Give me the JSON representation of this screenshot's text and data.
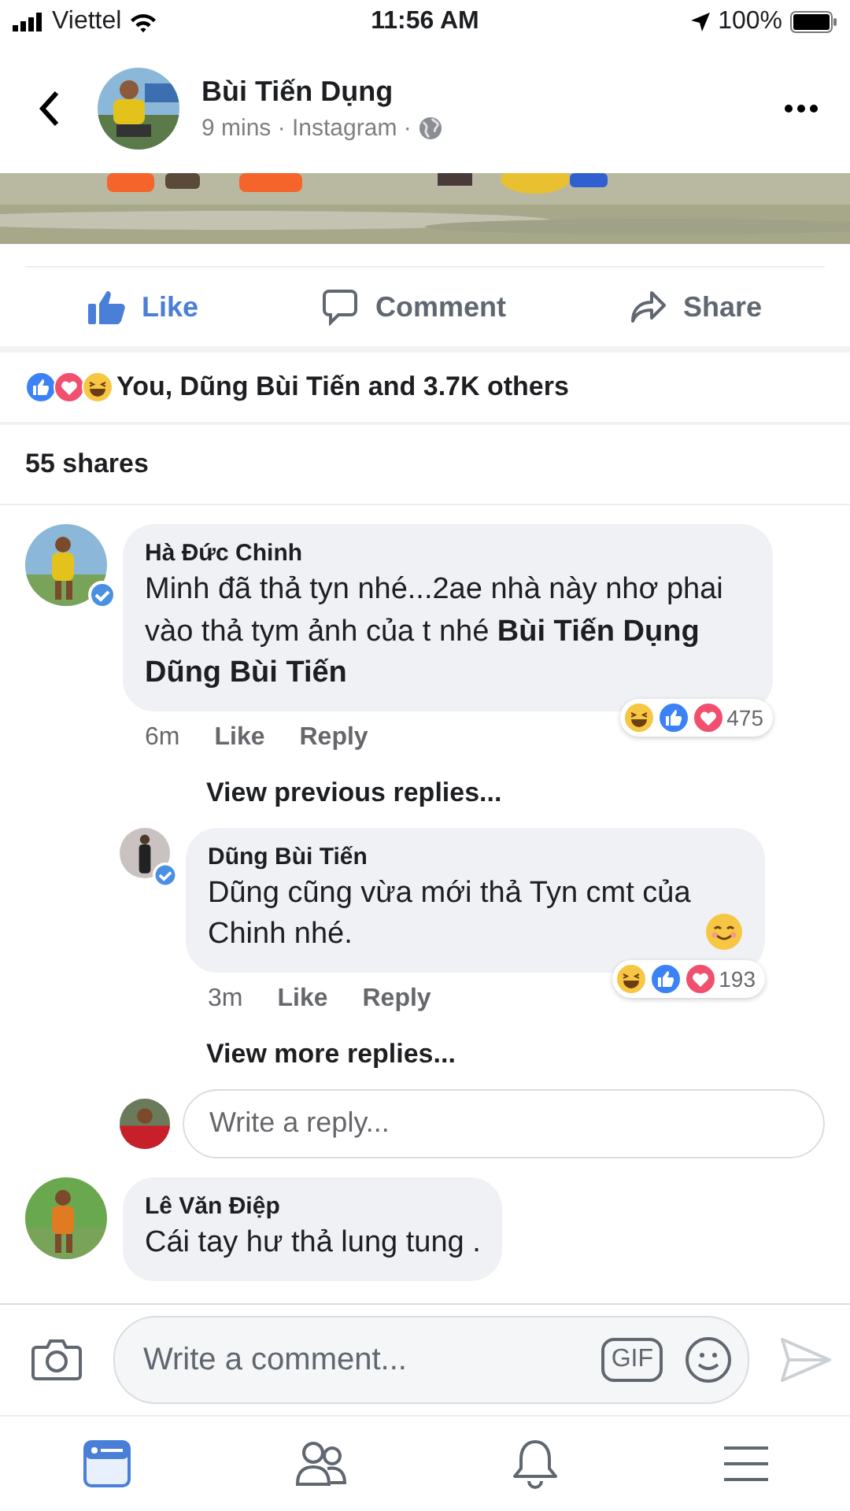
{
  "status_bar": {
    "carrier": "Viettel",
    "time": "11:56 AM",
    "battery": "100%"
  },
  "post": {
    "author": "Bùi Tiến Dụng",
    "meta": "9 mins · Instagram ·"
  },
  "actions": [
    {
      "kind": "like",
      "label": "Like",
      "selected": true
    },
    {
      "kind": "comment",
      "label": "Comment",
      "selected": false
    },
    {
      "kind": "share",
      "label": "Share",
      "selected": false
    }
  ],
  "reaction_summary": {
    "reactions": [
      {
        "kind": "like"
      },
      {
        "kind": "love"
      },
      {
        "kind": "haha"
      }
    ],
    "text": "You, Dũng Bùi Tiến and 3.7K others"
  },
  "shares": "55 shares",
  "comments": [
    {
      "name": "Hà Đức Chinh",
      "verified": true,
      "body": "Minh đã thả tyn nhé...2ae nhà này nhơ phai vào thả tym ảnh của t nhé **Bùi Tiến Dụng Dũng Bùi Tiến**",
      "time": "6m",
      "like": "Like",
      "reply": "Reply",
      "reactions": [
        {
          "kind": "haha"
        },
        {
          "kind": "like"
        },
        {
          "kind": "love"
        }
      ],
      "reaction_count": "475",
      "view_previous": "View previous replies...",
      "replies": [
        {
          "name": "Dũng Bùi Tiến",
          "verified": true,
          "body": "Dũng cũng vừa mới thả Tyn cmt của Chinh nhé.",
          "trailing": {
            "kind": "smile"
          },
          "time": "3m",
          "like": "Like",
          "reply": "Reply",
          "reactions": [
            {
              "kind": "haha"
            },
            {
              "kind": "like"
            },
            {
              "kind": "love"
            }
          ],
          "reaction_count": "193"
        }
      ],
      "view_more": "View more replies...",
      "reply_placeholder": "Write a reply..."
    },
    {
      "name": "Lê Văn Điệp",
      "verified": false,
      "body": "Cái tay hư thả lung tung ."
    }
  ],
  "composer": {
    "placeholder": "Write a comment...",
    "gif": "GIF"
  },
  "tab_bar": [
    {
      "kind": "feed",
      "selected": true
    },
    {
      "kind": "friends",
      "selected": false
    },
    {
      "kind": "bell",
      "selected": false
    },
    {
      "kind": "menu",
      "selected": false
    }
  ]
}
